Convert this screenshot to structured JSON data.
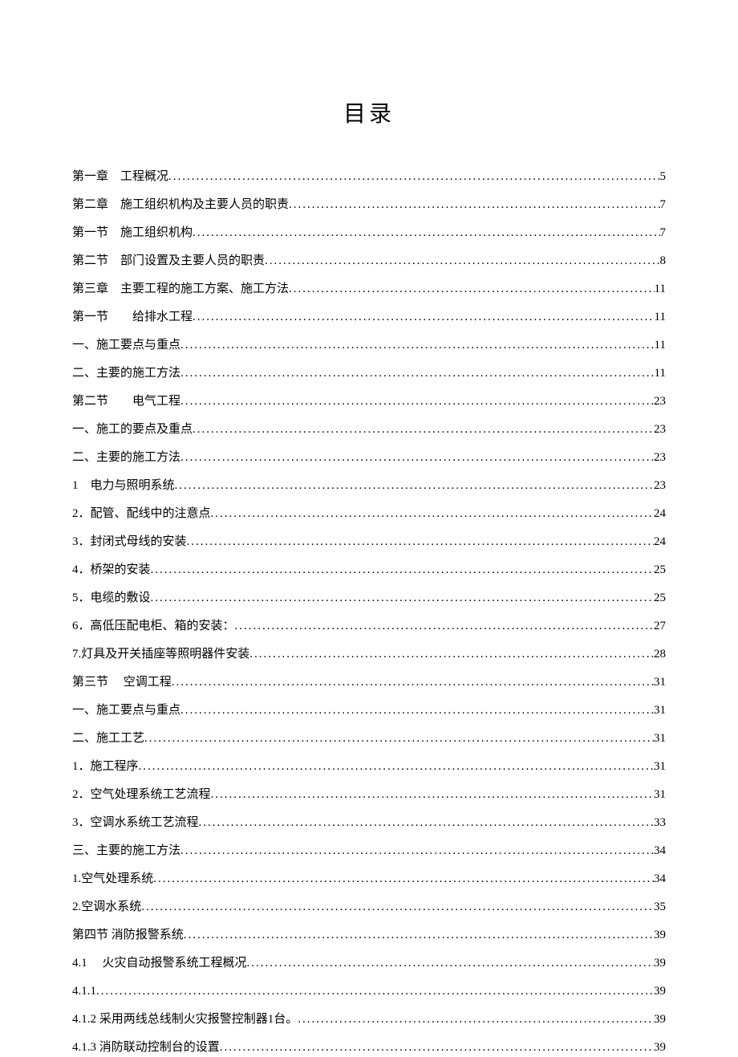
{
  "title": "目录",
  "entries": [
    {
      "text": "第一章　工程概况",
      "page": "5"
    },
    {
      "text": "第二章　施工组织机构及主要人员的职责",
      "page": "7"
    },
    {
      "text": "第一节　施工组织机构",
      "page": "7"
    },
    {
      "text": "第二节　部门设置及主要人员的职责",
      "page": "8"
    },
    {
      "text": "第三章　主要工程的施工方案、施工方法",
      "page": "11"
    },
    {
      "text": "第一节　　给排水工程",
      "page": "11"
    },
    {
      "text": "一、施工要点与重点",
      "page": "11"
    },
    {
      "text": "二、主要的施工方法",
      "page": "11"
    },
    {
      "text": "第二节　　电气工程",
      "page": "23"
    },
    {
      "text": "一、施工的要点及重点",
      "page": "23"
    },
    {
      "text": "二、主要的施工方法",
      "page": "23"
    },
    {
      "text": "1　电力与照明系统",
      "page": "23"
    },
    {
      "text": "2．配管、配线中的注意点",
      "page": "24"
    },
    {
      "text": "3．封闭式母线的安装",
      "page": "24"
    },
    {
      "text": "4．桥架的安装",
      "page": "25"
    },
    {
      "text": "5．电缆的敷设",
      "page": "25"
    },
    {
      "text": "6．高低压配电柜、箱的安装：",
      "page": "27"
    },
    {
      "text": "7.灯具及开关插座等照明器件安装",
      "page": "28"
    },
    {
      "text": "第三节　 空调工程",
      "page": "31"
    },
    {
      "text": "一、施工要点与重点",
      "page": "31"
    },
    {
      "text": "二、施工工艺",
      "page": "31"
    },
    {
      "text": "1．施工程序",
      "page": "31"
    },
    {
      "text": "2．空气处理系统工艺流程",
      "page": "31"
    },
    {
      "text": "3．空调水系统工艺流程",
      "page": "33"
    },
    {
      "text": "三、主要的施工方法",
      "page": "34"
    },
    {
      "text": "1.空气处理系统",
      "page": "34"
    },
    {
      "text": "2.空调水系统",
      "page": "35"
    },
    {
      "text": "第四节 消防报警系统",
      "page": "39"
    },
    {
      "text": "4.1 　火灾自动报警系统工程概况",
      "page": "39"
    },
    {
      "text": "4.1.1",
      "page": "39"
    },
    {
      "text": "4.1.2 采用两线总线制火灾报警控制器1台。",
      "page": "39"
    },
    {
      "text": "4.1.3 消防联动控制台的设置 ",
      "page": "39"
    }
  ]
}
